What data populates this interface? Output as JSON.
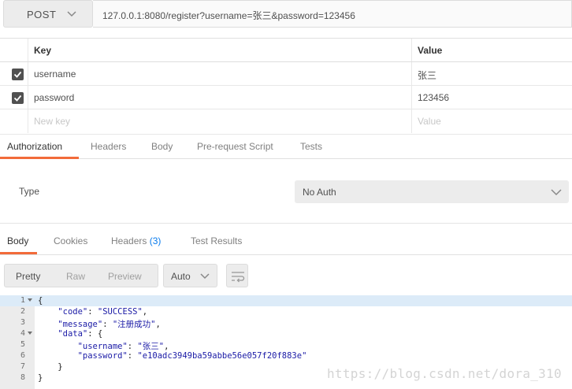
{
  "request": {
    "method": "POST",
    "url": "127.0.0.1:8080/register?username=张三&password=123456"
  },
  "params": {
    "headers": {
      "key": "Key",
      "value": "Value"
    },
    "rows": [
      {
        "checked": true,
        "key": "username",
        "value": "张三"
      },
      {
        "checked": true,
        "key": "password",
        "value": "123456"
      }
    ],
    "placeholder": {
      "key": "New key",
      "value": "Value"
    }
  },
  "request_tabs": [
    "Authorization",
    "Headers",
    "Body",
    "Pre-request Script",
    "Tests"
  ],
  "auth": {
    "type_label": "Type",
    "selected": "No Auth"
  },
  "response_tabs": {
    "body": "Body",
    "cookies": "Cookies",
    "headers": "Headers",
    "headers_count": "(3)",
    "test_results": "Test Results"
  },
  "view": {
    "modes": [
      "Pretty",
      "Raw",
      "Preview"
    ],
    "format": "Auto"
  },
  "response_lines": [
    {
      "num": "1",
      "fold": true
    },
    {
      "num": "2"
    },
    {
      "num": "3"
    },
    {
      "num": "4",
      "fold": true
    },
    {
      "num": "5"
    },
    {
      "num": "6"
    },
    {
      "num": "7"
    },
    {
      "num": "8"
    }
  ],
  "response": {
    "code_key": "\"code\"",
    "code_val": "\"SUCCESS\"",
    "message_key": "\"message\"",
    "message_val": "\"注册成功\"",
    "data_key": "\"data\"",
    "username_key": "\"username\"",
    "username_val": "\"张三\"",
    "password_key": "\"password\"",
    "password_val": "\"e10adc3949ba59abbe56e057f20f883e\""
  },
  "watermark": "https://blog.csdn.net/dora_310",
  "colors": {
    "accent": "#f26b3a",
    "link": "#097bed",
    "json_string": "#1a1aa6"
  }
}
